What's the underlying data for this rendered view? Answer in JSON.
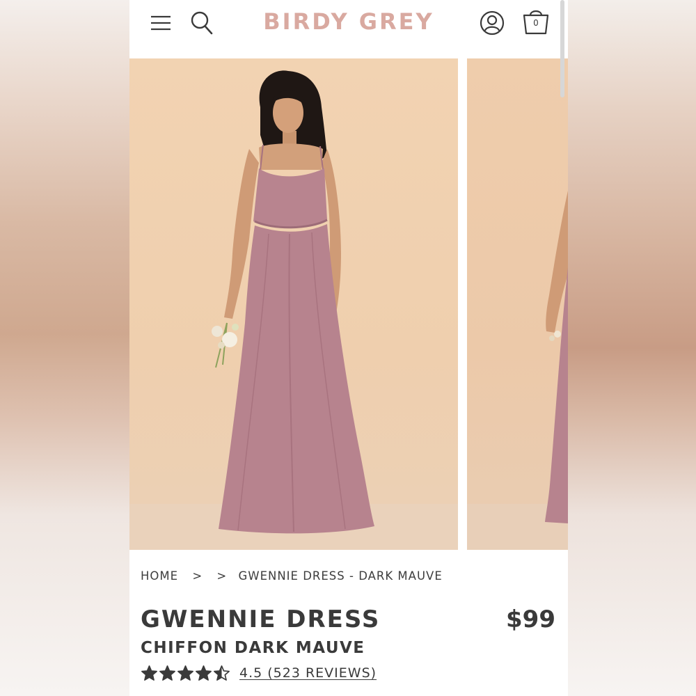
{
  "brand": {
    "logo_text": "BIRDY GREY",
    "logo_color": "#d9a9a0"
  },
  "header": {
    "icons": [
      "menu-icon",
      "search-icon",
      "account-icon",
      "bag-icon"
    ],
    "bag_count": "0"
  },
  "gallery": {
    "images": [
      {
        "name": "product-image-front",
        "dress_color": "#b98590"
      },
      {
        "name": "product-image-next",
        "dress_color": "#b98590"
      }
    ]
  },
  "breadcrumb": {
    "home": "HOME",
    "separator": ">",
    "current": "GWENNIE DRESS - DARK MAUVE"
  },
  "product": {
    "title": "GWENNIE DRESS",
    "subtitle": "CHIFFON DARK MAUVE",
    "price": "$99",
    "rating_value": 4.5,
    "rating_max": 5,
    "rating_text": "4.5 (523 REVIEWS)"
  },
  "colors": {
    "text": "#3a3a3a",
    "backdrop": "#e2cbbf"
  }
}
